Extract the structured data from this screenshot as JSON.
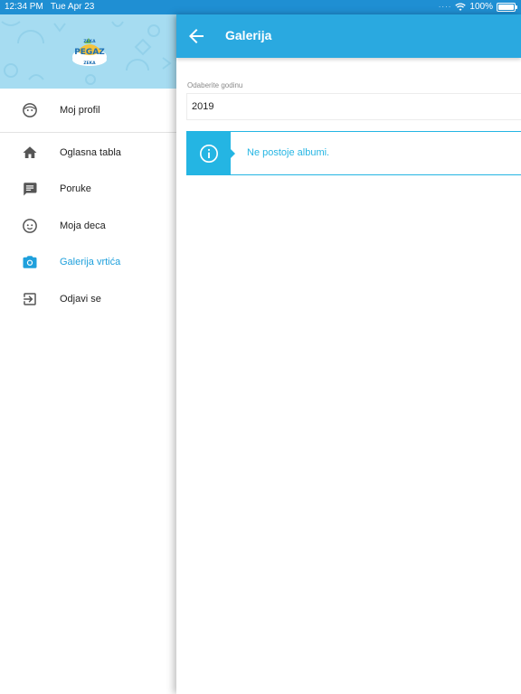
{
  "status_bar": {
    "time": "12:34 PM",
    "date": "Tue Apr 23",
    "battery_text": "100%",
    "battery_level": 1.0,
    "icons": [
      "wifi-icon",
      "battery-icon"
    ]
  },
  "drawer": {
    "logo_text_top": "ZEKA",
    "logo_text_main": "PEGAZ",
    "logo_text_bottom": "ZEKA",
    "profile_item": {
      "label": "Moj profil",
      "icon": "face-icon"
    },
    "items": [
      {
        "label": "Oglasna tabla",
        "icon": "home-icon"
      },
      {
        "label": "Poruke",
        "icon": "chat-icon"
      },
      {
        "label": "Moja deca",
        "icon": "child-icon"
      },
      {
        "label": "Galerija vrtića",
        "icon": "camera-icon",
        "active": true
      },
      {
        "label": "Odjavi se",
        "icon": "logout-icon"
      }
    ]
  },
  "app_bar": {
    "title": "Galerija",
    "back_icon": "arrow-back-icon"
  },
  "year_select": {
    "label": "Odaberite godinu",
    "value": "2019"
  },
  "info": {
    "icon": "info-icon",
    "message": "Ne postoje albumi."
  },
  "colors": {
    "primary": "#2aa9e0",
    "status_bar": "#1f8fd3",
    "accent": "#24b5e3",
    "active_text": "#1fa0dc",
    "drawer_header": "#a6dcf1"
  }
}
